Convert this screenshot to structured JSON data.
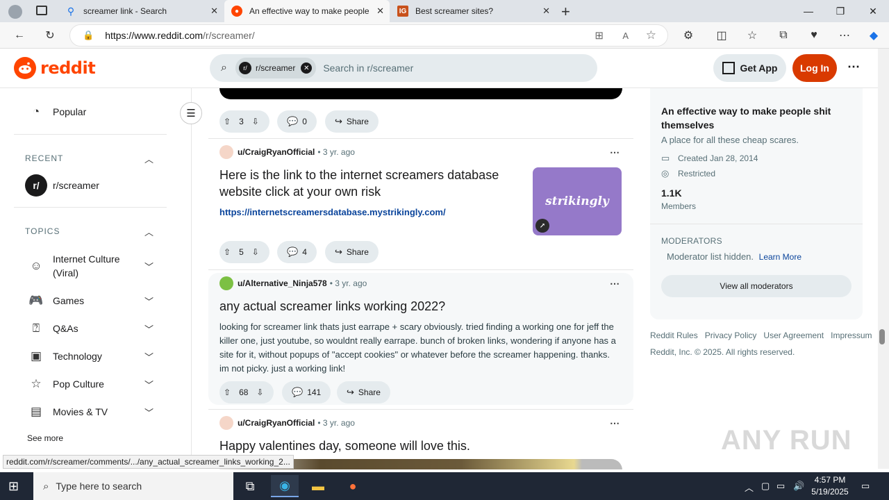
{
  "browser": {
    "tabs": [
      {
        "title": "screamer link - Search"
      },
      {
        "title": "An effective way to make people"
      },
      {
        "title": "Best screamer sites?"
      }
    ],
    "url_host": "https://www.reddit.com",
    "url_path": "/r/screamer/"
  },
  "header": {
    "brand": "reddit",
    "search_chip": "r/screamer",
    "search_placeholder": "Search in r/screamer",
    "get_app": "Get App",
    "login": "Log In"
  },
  "sidebar": {
    "popular": "Popular",
    "recent_heading": "RECENT",
    "recent_item": "r/screamer",
    "topics_heading": "TOPICS",
    "topics": [
      "Internet Culture (Viral)",
      "Games",
      "Q&As",
      "Technology",
      "Pop Culture",
      "Movies & TV"
    ],
    "see_more": "See more"
  },
  "feed": {
    "post0": {
      "votes": "3",
      "comments": "0",
      "share": "Share"
    },
    "post1": {
      "user": "u/CraigRyanOfficial",
      "age": "3 yr. ago",
      "title": "Here is the link to the internet screamers database website click at your own risk",
      "link": "https://internetscreamersdatabase.mystrikingly.com/",
      "thumb_text": "strikingly",
      "votes": "5",
      "comments": "4",
      "share": "Share"
    },
    "post2": {
      "user": "u/Alternative_Ninja578",
      "age": "3 yr. ago",
      "title": "any actual screamer links working 2022?",
      "body": "looking for screamer link thats just earrape + scary obviously. tried finding a working one for jeff the killer one, just youtube, so wouldnt really earrape. bunch of broken links, wondering if anyone has a site for it, without popups of \"accept cookies\" or whatever before the screamer happening. thanks. im not picky. just a working link!",
      "votes": "68",
      "comments": "141",
      "share": "Share"
    },
    "post3": {
      "user": "u/CraigRyanOfficial",
      "age": "3 yr. ago",
      "title": "Happy valentines day, someone will love this."
    }
  },
  "about": {
    "title": "An effective way to make people shit themselves",
    "description": "A place for all these cheap scares.",
    "created": "Created Jan 28, 2014",
    "restricted": "Restricted",
    "members_count": "1.1K",
    "members_label": "Members",
    "moderators_heading": "MODERATORS",
    "mod_hidden": "Moderator list hidden.",
    "learn_more": "Learn More",
    "view_mods": "View all moderators"
  },
  "footer": {
    "links": [
      "Reddit Rules",
      "Privacy Policy",
      "User Agreement",
      "Impressum"
    ],
    "copyright": "Reddit, Inc. © 2025. All rights reserved."
  },
  "status_url": "reddit.com/r/screamer/comments/.../any_actual_screamer_links_working_2...",
  "watermark": "ANY RUN",
  "taskbar": {
    "search_placeholder": "Type here to search",
    "time": "4:57 PM",
    "date": "5/19/2025"
  },
  "colors": {
    "brand": "#ff4500",
    "login": "#d93a00",
    "link": "#0a449b"
  }
}
